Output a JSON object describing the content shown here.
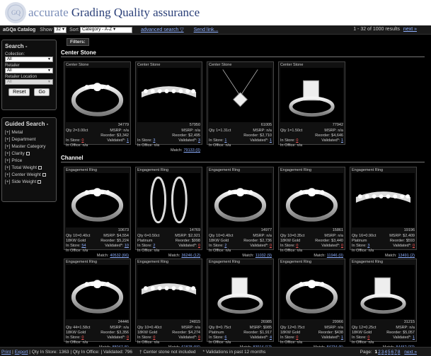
{
  "header": {
    "brand_prefix": "accurate",
    "brand_main": "Grading Quality assurance"
  },
  "toolbar": {
    "catalog_title": "aGQa Catalog",
    "show_label": "Show",
    "show_value": "32",
    "sort_label": "Sort",
    "sort_value": "Category - A-Z",
    "advanced_search": "advanced search ▽",
    "send_link": "Send link...",
    "range": "1 - 32 of 1000 results",
    "next": "next »"
  },
  "search": {
    "title": "Search -",
    "collection_label": "Collection:",
    "collection_value": "All",
    "retailer_label": "Retailer",
    "retailer_value": "All",
    "location_label": "Retailer Location",
    "location_value": "All",
    "reset": "Reset",
    "go": "Go"
  },
  "guided": {
    "title": "Guided Search -",
    "items": [
      "Metal",
      "Department",
      "Master Category",
      "Clarity",
      "Price",
      "Total Weight",
      "Center Weight",
      "Side Weight"
    ]
  },
  "filters_label": "Filters:",
  "sections": {
    "center_stone": "Center Stone",
    "channel": "Channel"
  },
  "labels": {
    "msrp": "MSRP:",
    "reorder": "Reorder:",
    "in_store": "In Store:",
    "validated": "Validated",
    "in_office": "In Office:",
    "match": "Match:"
  },
  "center_cards": [
    {
      "title": "Center Stone",
      "id": "34779",
      "qty": "Qty 2=3.00ct",
      "metal": "",
      "msrp": "n/a",
      "reorder": "$3,342",
      "in_store": "0",
      "validated": "1",
      "in_office": "n/a",
      "match": ""
    },
    {
      "title": "Center Stone",
      "id": "57950",
      "qty": "",
      "metal": "",
      "msrp": "n/a",
      "reorder": "$2,495",
      "in_store": "3",
      "validated": "3",
      "in_office": "n/a",
      "match": "79133 (0)"
    },
    {
      "title": "Center Stone",
      "id": "61005",
      "qty": "Qty 1=1.31ct",
      "metal": "",
      "msrp": "n/a",
      "reorder": "$2,710",
      "in_store": "1",
      "validated": "1",
      "in_office": "n/a",
      "match": ""
    },
    {
      "title": "Center Stone",
      "id": "77942",
      "qty": "Qty 1=1.50ct",
      "metal": "",
      "msrp": "n/a",
      "reorder": "$4,646",
      "in_store": "0",
      "validated": "1",
      "in_office": "n/a",
      "match": ""
    }
  ],
  "channel_row1": [
    {
      "title": "Engagement Ring",
      "id": "10673",
      "qty": "Qty 10=0.40ct",
      "metal": "18KW Gold",
      "msrp": "$4,554",
      "reorder": "$5,224",
      "in_store": "54",
      "validated": "10",
      "in_office": "n/a",
      "match": "40532 (66)"
    },
    {
      "title": "Engagement Ring",
      "id": "14769",
      "qty": "Qty 6=0.50ct",
      "metal": "Platinum",
      "msrp": "$2,921",
      "reorder": "$998",
      "in_store": "2",
      "validated": "0",
      "in_office": "n/a",
      "match": "36246 (12)"
    },
    {
      "title": "Engagement Ring",
      "id": "14977",
      "qty": "Qty 10=0.40ct",
      "metal": "18KW Gold",
      "msrp": "n/a",
      "reorder": "$2,736",
      "in_store": "2",
      "validated": "0",
      "in_office": "n/a",
      "match": "11032 (9)"
    },
    {
      "title": "Engagement Ring",
      "id": "15861",
      "qty": "Qty 10=0.35ct",
      "metal": "18KW Gold",
      "msrp": "n/a",
      "reorder": "$3,440",
      "in_store": "0",
      "validated": "0",
      "in_office": "n/a",
      "match": "11946 (0)"
    },
    {
      "title": "Engagement Ring",
      "id": "19196",
      "qty": "Qty 16=0.90ct",
      "metal": "Platinum",
      "msrp": "$2,409",
      "reorder": "$593",
      "in_store": "3",
      "validated": "0",
      "in_office": "n/a",
      "match": "13491 (2)"
    }
  ],
  "channel_row2": [
    {
      "title": "Engagement Ring",
      "id": "24446",
      "qty": "Qty 44=1.58ct",
      "metal": "18KW Gold",
      "msrp": "n/a",
      "reorder": "$3,356",
      "in_store": "0",
      "validated": "0",
      "in_office": "n/a",
      "match": "88047 (5)"
    },
    {
      "title": "Engagement Ring",
      "id": "24815",
      "qty": "Qty 10=0.40ct",
      "metal": "18KW Gold",
      "msrp": "n/a",
      "reorder": "$4,274",
      "in_store": "0",
      "validated": "0",
      "in_office": "n/a",
      "match": "61878 (66)"
    },
    {
      "title": "Engagement Ring",
      "id": "26985",
      "qty": "Qty 8=0.75ct",
      "metal": "Platinum",
      "msrp": "$985",
      "reorder": "$1,917",
      "in_store": "6",
      "validated": "4",
      "in_office": "n/a",
      "match": "83914 (12)"
    },
    {
      "title": "Engagement Ring",
      "id": "29966",
      "qty": "Qty 12=0.75ct",
      "metal": "18KW Gold",
      "msrp": "n/a",
      "reorder": "$438",
      "in_store": "0",
      "validated": "1",
      "in_office": "n/a",
      "match": "84734 (5)"
    },
    {
      "title": "Engagement Ring",
      "id": "31215",
      "qty": "Qty 12=0.25ct",
      "metal": "18KW Gold",
      "msrp": "n/a",
      "reorder": "$5,057",
      "in_store": "0",
      "validated": "1",
      "in_office": "n/a",
      "match": "84452 (32)"
    }
  ],
  "footer": {
    "print": "Print",
    "export": "Export",
    "summary": "| Qty In Store: 1363 | Qty In Office: | Validated: 796",
    "note1": "Center stone not included",
    "note2": "Validations in past 12 months",
    "page_label": "Page:",
    "current_page": "1",
    "pages": [
      "2",
      "3",
      "4",
      "5",
      "6",
      "7",
      "8"
    ],
    "next": "next »"
  }
}
